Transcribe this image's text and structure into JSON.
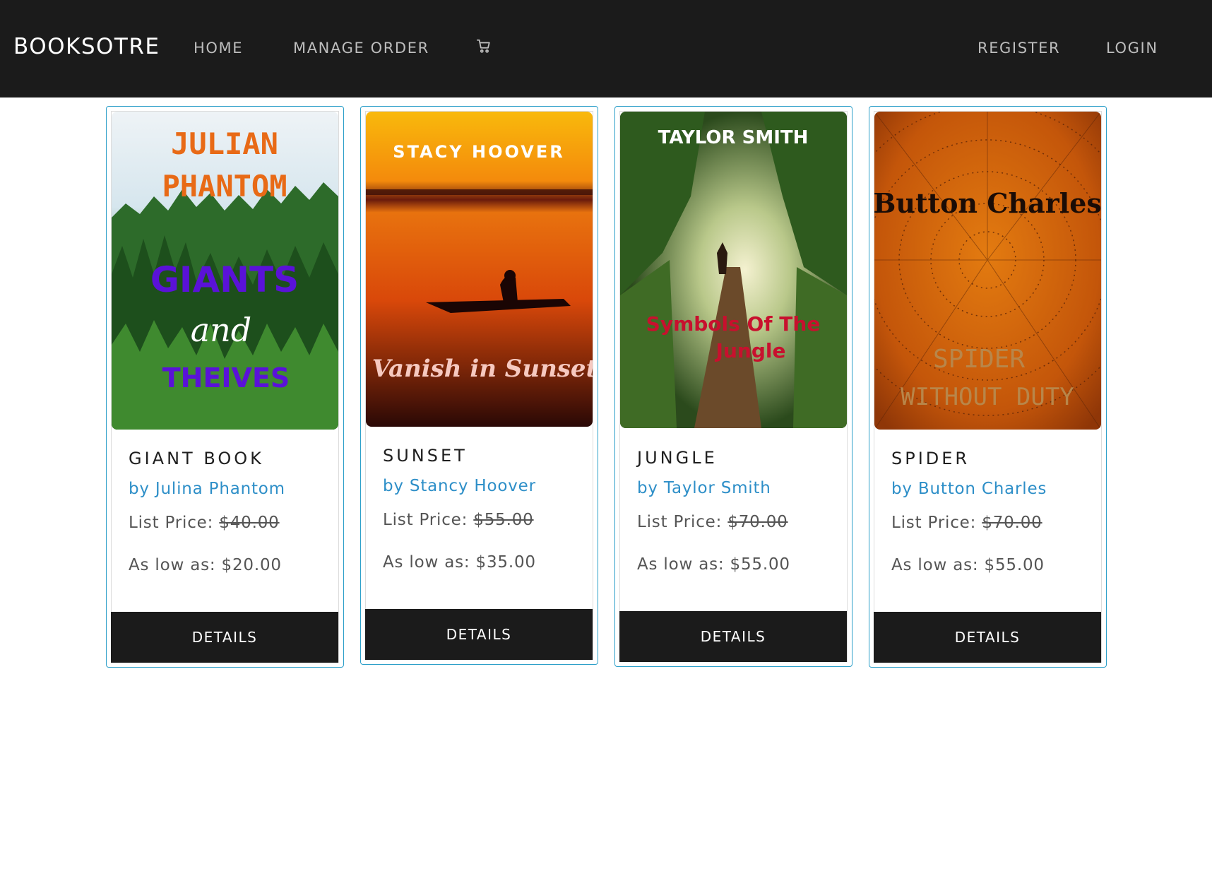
{
  "navbar": {
    "brand": "BOOKSOTRE",
    "links": {
      "home": "HOME",
      "manage_order": "MANAGE ORDER",
      "register": "REGISTER",
      "login": "LOGIN"
    },
    "cart_icon": "shopping-cart-icon"
  },
  "books": [
    {
      "title": "GIANT BOOK",
      "author": "by Julina Phantom",
      "list_price_label": "List Price: ",
      "list_price": "$40.00",
      "low_price": "As low as: $20.00",
      "details_label": "DETAILS",
      "cover": {
        "line1": "JULIAN",
        "line2": "PHANTOM",
        "line3": "GIANTS",
        "line4": "and",
        "line5": "THEIVES"
      }
    },
    {
      "title": "SUNSET",
      "author": "by Stancy Hoover",
      "list_price_label": "List Price: ",
      "list_price": "$55.00",
      "low_price": "As low as: $35.00",
      "details_label": "DETAILS",
      "cover": {
        "line1": "STACY HOOVER",
        "line2": "Vanish in Sunset"
      }
    },
    {
      "title": "JUNGLE",
      "author": "by Taylor Smith",
      "list_price_label": "List Price: ",
      "list_price": "$70.00",
      "low_price": "As low as: $55.00",
      "details_label": "DETAILS",
      "cover": {
        "line1": "TAYLOR SMITH",
        "line2": "Symbols Of The",
        "line3": "Jungle"
      }
    },
    {
      "title": "SPIDER",
      "author": "by Button Charles",
      "list_price_label": "List Price: ",
      "list_price": "$70.00",
      "low_price": "As low as: $55.00",
      "details_label": "DETAILS",
      "cover": {
        "line1": "Button Charles",
        "line2": "SPIDER",
        "line3": "WITHOUT DUTY"
      }
    }
  ],
  "colors": {
    "navbar_bg": "#1b1b1b",
    "card_border": "#2c9fc9",
    "author_link": "#2e8fc8",
    "button_bg": "#1b1b1b"
  }
}
